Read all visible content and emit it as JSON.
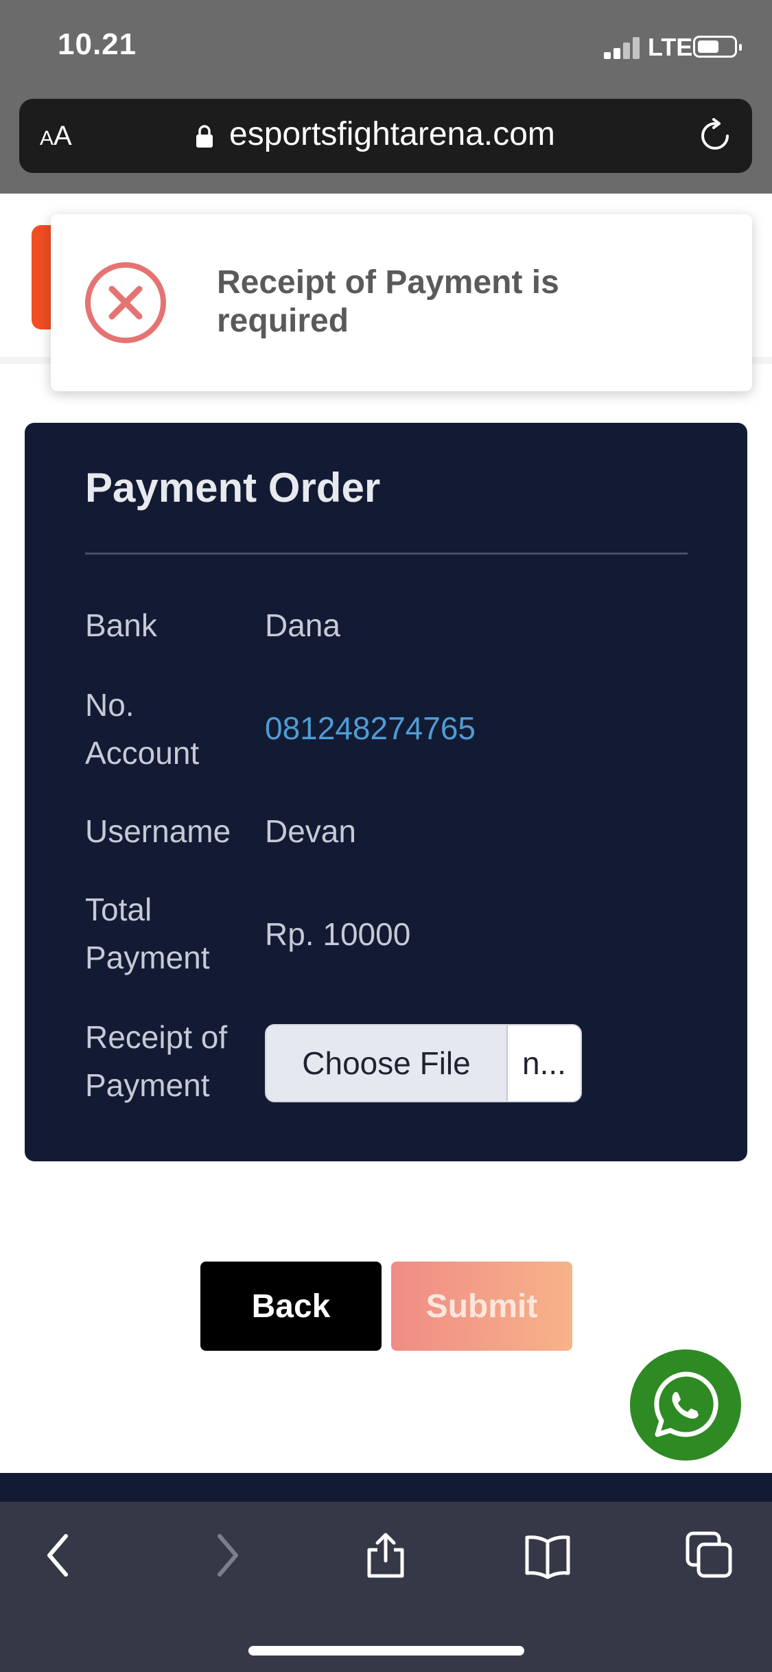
{
  "status_bar": {
    "time": "10.21",
    "network": "LTE"
  },
  "browser": {
    "text_size_label": "AA",
    "url": "esportsfightarena.com"
  },
  "toast": {
    "message": "Receipt of Payment is required"
  },
  "payment": {
    "title": "Payment Order",
    "rows": [
      {
        "label": "Bank",
        "value": "Dana"
      },
      {
        "label": "No. Account",
        "value": "081248274765"
      },
      {
        "label": "Username",
        "value": "Devan"
      },
      {
        "label": "Total Payment",
        "value": "Rp. 10000"
      }
    ],
    "receipt_label": "Receipt of Payment",
    "file_button_label": "Choose File",
    "file_name_display": "n..."
  },
  "actions": {
    "back_label": "Back",
    "submit_label": "Submit"
  },
  "colors": {
    "card_bg": "#131b34",
    "link": "#4e9dd4",
    "error": "#e57373",
    "whatsapp": "#2e8a22"
  }
}
